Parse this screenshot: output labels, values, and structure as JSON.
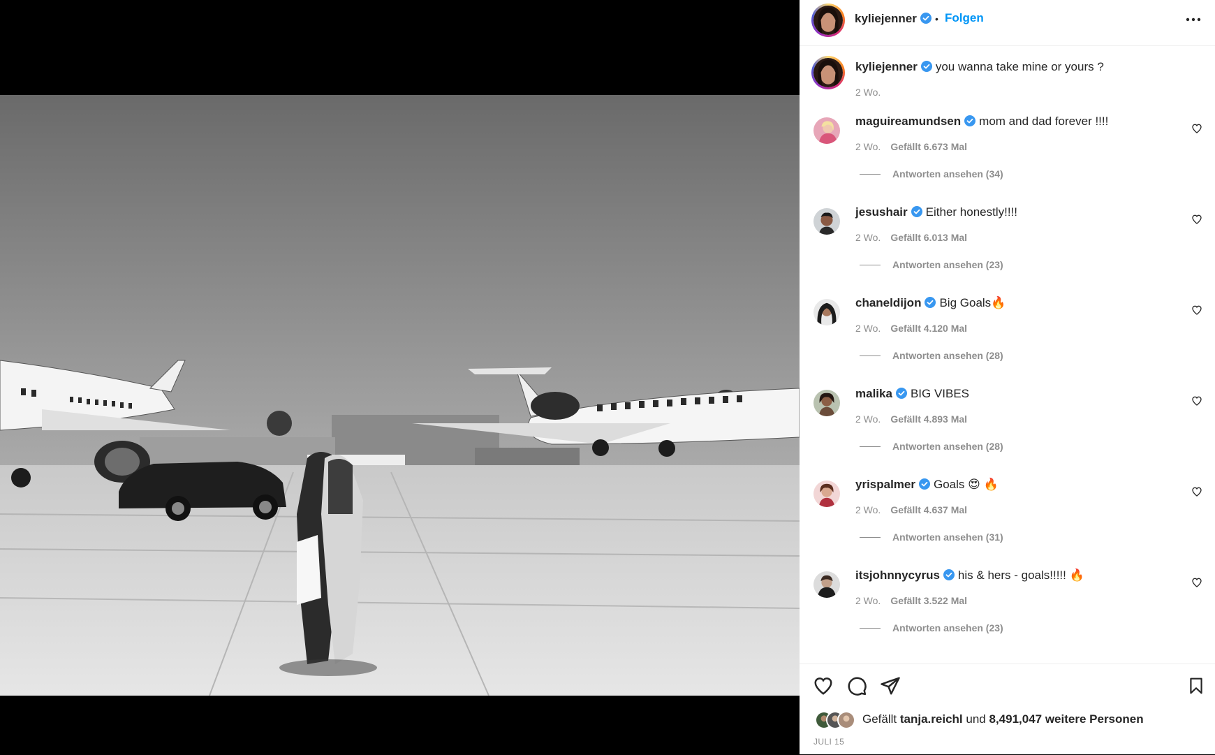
{
  "header": {
    "username": "kyliejenner",
    "separator": "•",
    "follow_label": "Folgen"
  },
  "caption": {
    "username": "kyliejenner",
    "text": "you wanna take mine or yours ?",
    "time": "2 Wo."
  },
  "comments": [
    {
      "username": "maguireamundsen",
      "text": "mom and dad forever !!!!",
      "time": "2 Wo.",
      "likes": "Gefällt 6.673 Mal",
      "replies": "Antworten ansehen (34)"
    },
    {
      "username": "jesushair",
      "text": "Either honestly!!!!",
      "time": "2 Wo.",
      "likes": "Gefällt 6.013 Mal",
      "replies": "Antworten ansehen (23)"
    },
    {
      "username": "chaneldijon",
      "text": "Big Goals🔥",
      "time": "2 Wo.",
      "likes": "Gefällt 4.120 Mal",
      "replies": "Antworten ansehen (28)"
    },
    {
      "username": "malika",
      "text": "BIG VIBES",
      "time": "2 Wo.",
      "likes": "Gefällt 4.893 Mal",
      "replies": "Antworten ansehen (28)"
    },
    {
      "username": "yrispalmer",
      "text": "Goals 😍 🔥",
      "time": "2 Wo.",
      "likes": "Gefällt 4.637 Mal",
      "replies": "Antworten ansehen (31)"
    },
    {
      "username": "itsjohnnycyrus",
      "text": "his & hers - goals!!!!! 🔥",
      "time": "2 Wo.",
      "likes": "Gefällt 3.522 Mal",
      "replies": "Antworten ansehen (23)"
    }
  ],
  "likes_summary": {
    "prefix": "Gefällt",
    "user": "tanja.reichl",
    "middle": "und",
    "count": "8,491,047 weitere Personen"
  },
  "date": "JULI 15",
  "colors": {
    "accent": "#0095f6",
    "text": "#262626",
    "muted": "#8e8e8e",
    "verified": "#3897f0"
  },
  "icons": {
    "verified": "verified-badge-icon",
    "more": "more-options-icon",
    "like": "heart-icon",
    "comment": "comment-icon",
    "share": "share-icon",
    "save": "bookmark-icon"
  }
}
